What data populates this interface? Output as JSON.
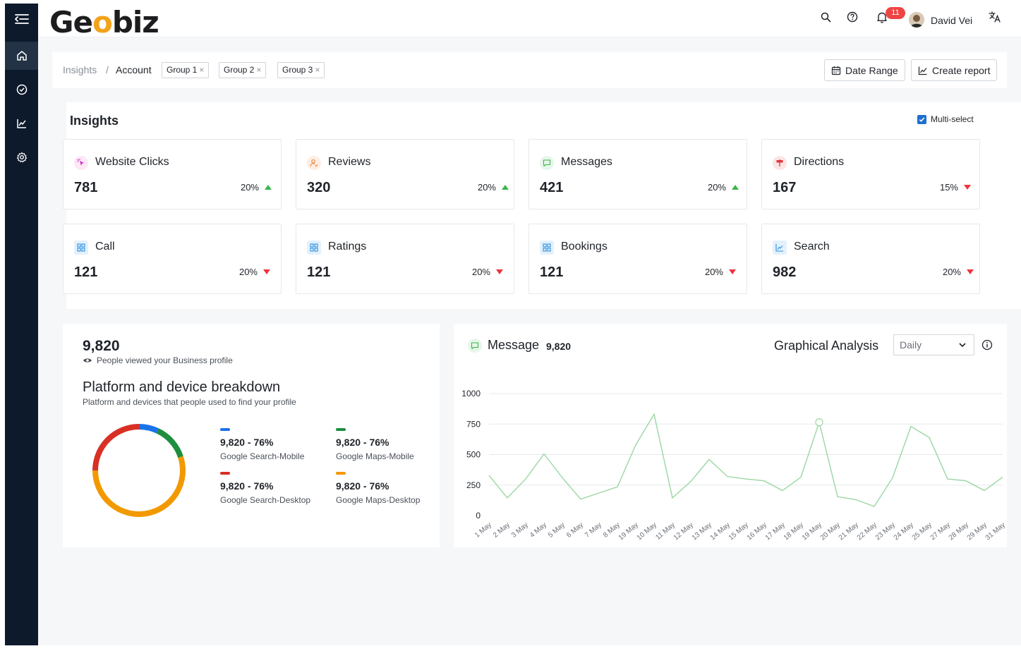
{
  "brand": {
    "logo_left": "Ge",
    "logo_pin": "o",
    "logo_right": "biz"
  },
  "header": {
    "notification_count": "11",
    "user_name": "David Vei"
  },
  "breadcrumb": {
    "root": "Insights",
    "separator": "/",
    "current": "Account"
  },
  "groups": [
    "Group 1",
    "Group 2",
    "Group 3"
  ],
  "chip_close": "×",
  "actions": {
    "date_range": "Date Range",
    "create_report": "Create report"
  },
  "insights": {
    "title": "Insights",
    "multi_select_label": "Multi-select",
    "cards": [
      {
        "label": "Website Clicks",
        "value": "781",
        "change": "20%",
        "trend": "up",
        "icon": "cursor-click-icon"
      },
      {
        "label": "Reviews",
        "value": "320",
        "change": "20%",
        "trend": "up",
        "icon": "user-review-icon"
      },
      {
        "label": "Messages",
        "value": "421",
        "change": "20%",
        "trend": "up",
        "icon": "message-icon"
      },
      {
        "label": "Directions",
        "value": "167",
        "change": "15%",
        "trend": "down",
        "icon": "signpost-icon"
      },
      {
        "label": "Call",
        "value": "121",
        "change": "20%",
        "trend": "down",
        "icon": "grid-icon"
      },
      {
        "label": "Ratings",
        "value": "121",
        "change": "20%",
        "trend": "down",
        "icon": "grid-icon"
      },
      {
        "label": "Bookings",
        "value": "121",
        "change": "20%",
        "trend": "down",
        "icon": "grid-icon"
      },
      {
        "label": "Search",
        "value": "982",
        "change": "20%",
        "trend": "down",
        "icon": "line-chart-icon"
      }
    ]
  },
  "breakdown": {
    "total": "9,820",
    "viewed_label": "People viewed your Business profile",
    "title": "Platform and device breakdown",
    "subtitle": "Platform and devices that people used to find your profile",
    "legend": [
      {
        "value": "9,820 - 76%",
        "label": "Google Search-Mobile",
        "color": "#1a73e8"
      },
      {
        "value": "9,820 - 76%",
        "label": "Google Maps-Mobile",
        "color": "#1e8e3e"
      },
      {
        "value": "9,820 - 76%",
        "label": "Google Search-Desktop",
        "color": "#d93025"
      },
      {
        "value": "9,820 - 76%",
        "label": "Google Maps-Desktop",
        "color": "#f29900"
      }
    ],
    "donut_segments": [
      {
        "color": "#1a73e8",
        "fraction": 0.07
      },
      {
        "color": "#1e8e3e",
        "fraction": 0.13
      },
      {
        "color": "#f29900",
        "fraction": 0.55
      },
      {
        "color": "#d93025",
        "fraction": 0.25
      }
    ]
  },
  "message_panel": {
    "title": "Message",
    "count": "9,820",
    "analysis_title": "Graphical Analysis",
    "period": "Daily"
  },
  "chart_data": {
    "type": "line",
    "x": [
      "1 May",
      "2 May",
      "3 May",
      "4 May",
      "5 May",
      "6 May",
      "7 May",
      "8 May",
      "19 May",
      "10 May",
      "11 May",
      "12 May",
      "13 May",
      "14 May",
      "15 May",
      "16 May",
      "17 May",
      "18 May",
      "19 May",
      "20 May",
      "21 May",
      "22 May",
      "23 May",
      "24 May",
      "25 May",
      "27 May",
      "28 May",
      "29 May",
      "31 May"
    ],
    "series": [
      {
        "values": [
          330,
          145,
          300,
          505,
          310,
          135,
          185,
          235,
          580,
          830,
          145,
          280,
          460,
          320,
          300,
          285,
          205,
          315,
          765,
          155,
          130,
          75,
          310,
          730,
          640,
          300,
          285,
          205,
          315
        ]
      }
    ],
    "yticks": [
      0,
      250,
      500,
      750,
      1000
    ],
    "ylim": [
      0,
      1000
    ],
    "highlight_index": 18,
    "line_color": "#9ad7a2",
    "grid": true
  }
}
